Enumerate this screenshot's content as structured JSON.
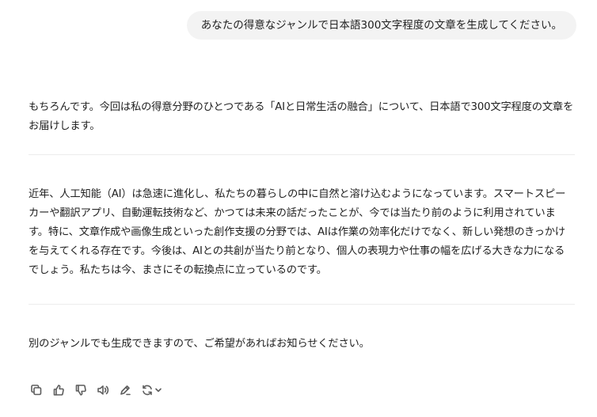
{
  "user_message": "あなたの得意なジャンルで日本語300文字程度の文章を生成してください。",
  "assistant": {
    "intro": "もちろんです。今回は私の得意分野のひとつである「AIと日常生活の融合」について、日本語で300文字程度の文章をお届けします。",
    "body": "近年、人工知能（AI）は急速に進化し、私たちの暮らしの中に自然と溶け込むようになっています。スマートスピーカーや翻訳アプリ、自動運転技術など、かつては未来の話だったことが、今では当たり前のように利用されています。特に、文章作成や画像生成といった創作支援の分野では、AIは作業の効率化だけでなく、新しい発想のきっかけを与えてくれる存在です。今後は、AIとの共創が当たり前となり、個人の表現力や仕事の幅を広げる大きな力になるでしょう。私たちは今、まさにその転換点に立っているのです。",
    "outro": "別のジャンルでも生成できますので、ご希望があればお知らせください。"
  },
  "actions": [
    "copy-icon",
    "thumbs-up-icon",
    "thumbs-down-icon",
    "speaker-icon",
    "edit-icon",
    "regenerate-icon"
  ]
}
